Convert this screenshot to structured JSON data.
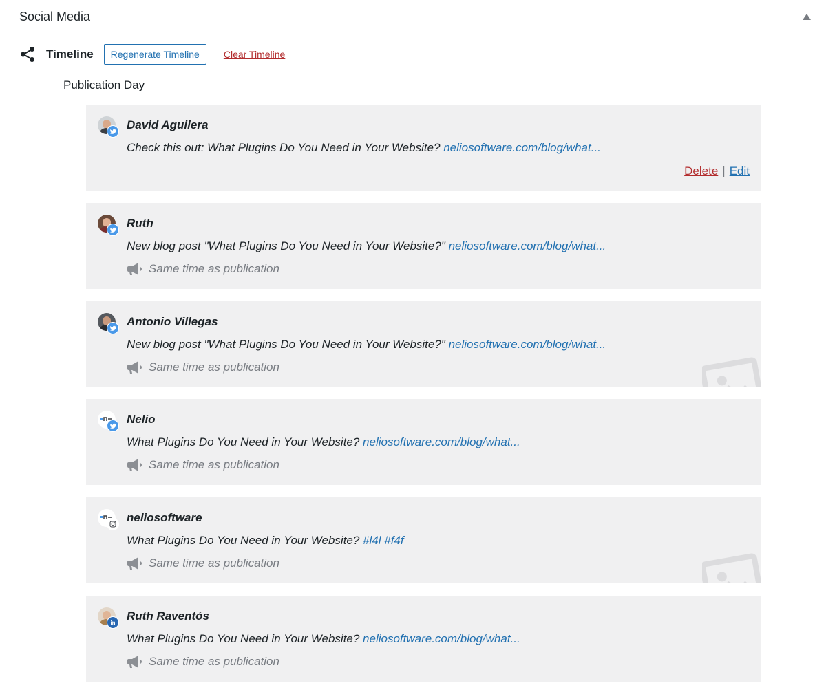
{
  "panel": {
    "title": "Social Media"
  },
  "timeline": {
    "label": "Timeline",
    "regenerate_label": "Regenerate Timeline",
    "clear_label": "Clear Timeline"
  },
  "day_label": "Publication Day",
  "colors": {
    "accent": "#2271b1",
    "danger": "#b32d2e",
    "muted": "#787c82",
    "card_bg": "#f0f0f1",
    "twitter": "#4a99e9",
    "linkedin": "#2867b2",
    "instagram": "#ffffff"
  },
  "posts": [
    {
      "author": "David Aguilera",
      "network": "twitter-icon",
      "text": "Check this out: What Plugins Do You Need in Your Website? ",
      "link": "neliosoftware.com/blog/what...",
      "delete_label": "Delete",
      "separator": "|",
      "edit_label": "Edit"
    },
    {
      "author": "Ruth",
      "network": "twitter-icon",
      "text": "New blog post \"What Plugins Do You Need in Your Website?\" ",
      "link": "neliosoftware.com/blog/what...",
      "schedule": "Same time as publication"
    },
    {
      "author": "Antonio Villegas",
      "network": "twitter-icon",
      "text": "New blog post \"What Plugins Do You Need in Your Website?\" ",
      "link": "neliosoftware.com/blog/what...",
      "schedule": "Same time as publication"
    },
    {
      "author": "Nelio",
      "network": "twitter-icon",
      "text": "What Plugins Do You Need in Your Website? ",
      "link": "neliosoftware.com/blog/what...",
      "schedule": "Same time as publication"
    },
    {
      "author": "neliosoftware",
      "network": "instagram-icon",
      "text": "What Plugins Do You Need in Your Website? ",
      "link": "#l4l #f4f",
      "schedule": "Same time as publication"
    },
    {
      "author": "Ruth Raventós",
      "network": "linkedin-icon",
      "text": "What Plugins Do You Need in Your Website? ",
      "link": "neliosoftware.com/blog/what...",
      "schedule": "Same time as publication"
    }
  ]
}
